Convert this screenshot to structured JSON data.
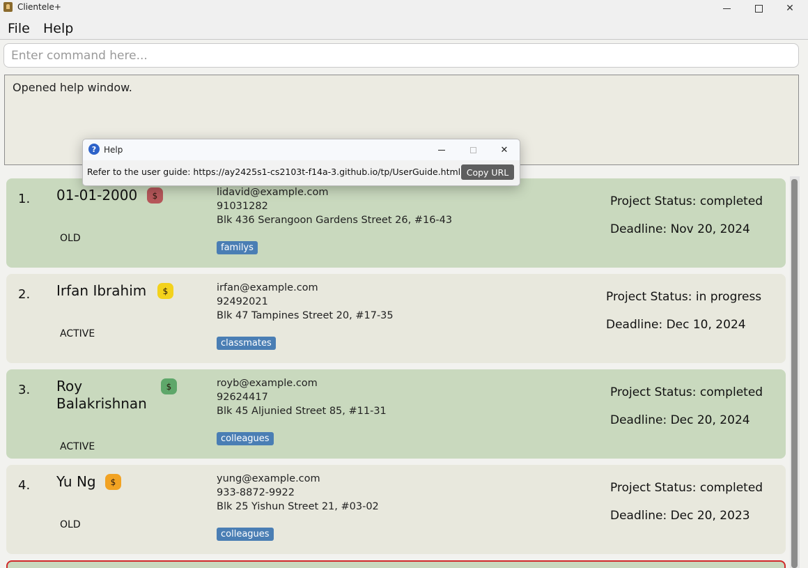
{
  "window": {
    "title": "Clientele+",
    "minimize_icon": "minimize-icon",
    "maximize_icon": "maximize-icon",
    "close_icon": "close-icon"
  },
  "menu": {
    "items": [
      {
        "label": "File"
      },
      {
        "label": "Help"
      }
    ]
  },
  "command": {
    "placeholder": "Enter command here...",
    "value": ""
  },
  "result": {
    "text": "Opened help window."
  },
  "clients": [
    {
      "index": "1.",
      "name": "01-01-2000",
      "status": "OLD",
      "payment_color": "#b6575a",
      "payment_symbol": "$",
      "email": "lidavid@example.com",
      "phone": "91031282",
      "address": "Blk 436 Serangoon Gardens Street 26, #16-43",
      "tag": "familys",
      "project_status": "Project Status: completed",
      "deadline": "Deadline: Nov 20, 2024"
    },
    {
      "index": "2.",
      "name": "Irfan Ibrahim",
      "status": "ACTIVE",
      "payment_color": "#f3d21c",
      "payment_symbol": "$",
      "email": "irfan@example.com",
      "phone": "92492021",
      "address": "Blk 47 Tampines Street 20, #17-35",
      "tag": "classmates",
      "project_status": "Project Status: in progress",
      "deadline": "Deadline: Dec 10, 2024"
    },
    {
      "index": "3.",
      "name_line1": "Roy",
      "name_line2": "Balakrishnan",
      "status": "ACTIVE",
      "payment_color": "#5ea76a",
      "payment_symbol": "$",
      "email": "royb@example.com",
      "phone": "92624417",
      "address": "Blk 45 Aljunied Street 85, #11-31",
      "tag": "colleagues",
      "project_status": "Project Status: completed",
      "deadline": "Deadline: Dec 20, 2024"
    },
    {
      "index": "4.",
      "name": "Yu Ng",
      "status": "OLD",
      "payment_color": "#f2a323",
      "payment_symbol": "$",
      "email": "yung@example.com",
      "phone": "933-8872-9922",
      "address": "Blk 25 Yishun Street 21, #03-02",
      "tag": "colleagues",
      "project_status": "Project Status: completed",
      "deadline": "Deadline: Dec 20, 2023"
    }
  ],
  "help_dialog": {
    "title": "Help",
    "icon": "question-icon",
    "message": "Refer to the user guide: https://ay2425s1-cs2103t-f14a-3.github.io/tp/UserGuide.html",
    "copy_button": "Copy URL"
  }
}
